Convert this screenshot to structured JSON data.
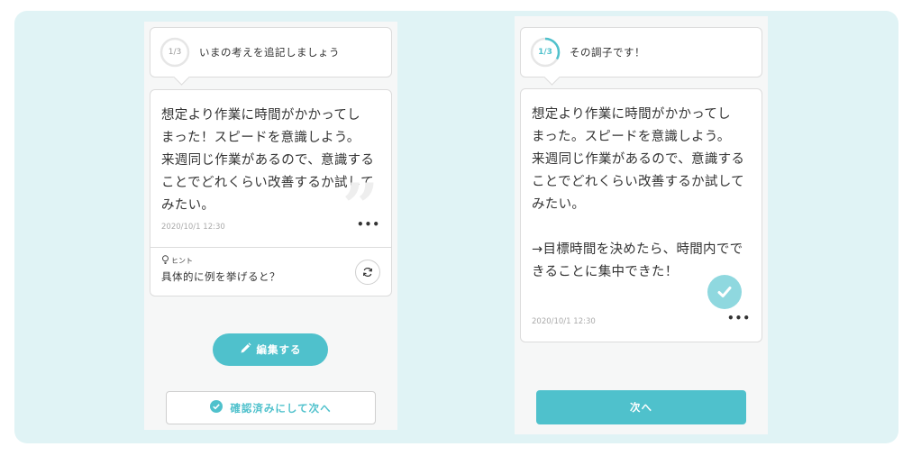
{
  "left_screen": {
    "progress_label": "1/3",
    "progress_fraction": 0,
    "header_text": "いまの考えを追記しましょう",
    "entry_text": "想定より作業に時間がかかってし\nまった！スピードを意識しよう。\n来週同じ作業があるので、意識する\nことでどれくらい改善するか試して\nみたい。",
    "date": "2020/10/1 12:30",
    "more_label": "•••",
    "hint_label": "ヒント",
    "hint_text": "具体的に例を挙げると？",
    "edit_button": "編集する",
    "confirm_button": "確認済みにして次へ"
  },
  "right_screen": {
    "progress_label": "1/3",
    "progress_fraction": 0.333,
    "header_text": "その調子です！",
    "entry_text": "想定より作業に時間がかかってし\nまった。スピードを意識しよう。\n来週同じ作業があるので、意識する\nことでどれくらい改善するか試して\nみたい。\n\n→目標時間を決めたら、時間内でで\nきることに集中できた！",
    "date": "2020/10/1 12:30",
    "more_label": "•••",
    "next_button": "次へ"
  },
  "colors": {
    "accent": "#4fc1cc",
    "backdrop": "#e0f3f5",
    "check_badge": "#8fd8df"
  },
  "icons": [
    "quote-icon",
    "lightbulb-icon",
    "refresh-icon",
    "pencil-icon",
    "check-circle-icon",
    "check-icon"
  ]
}
